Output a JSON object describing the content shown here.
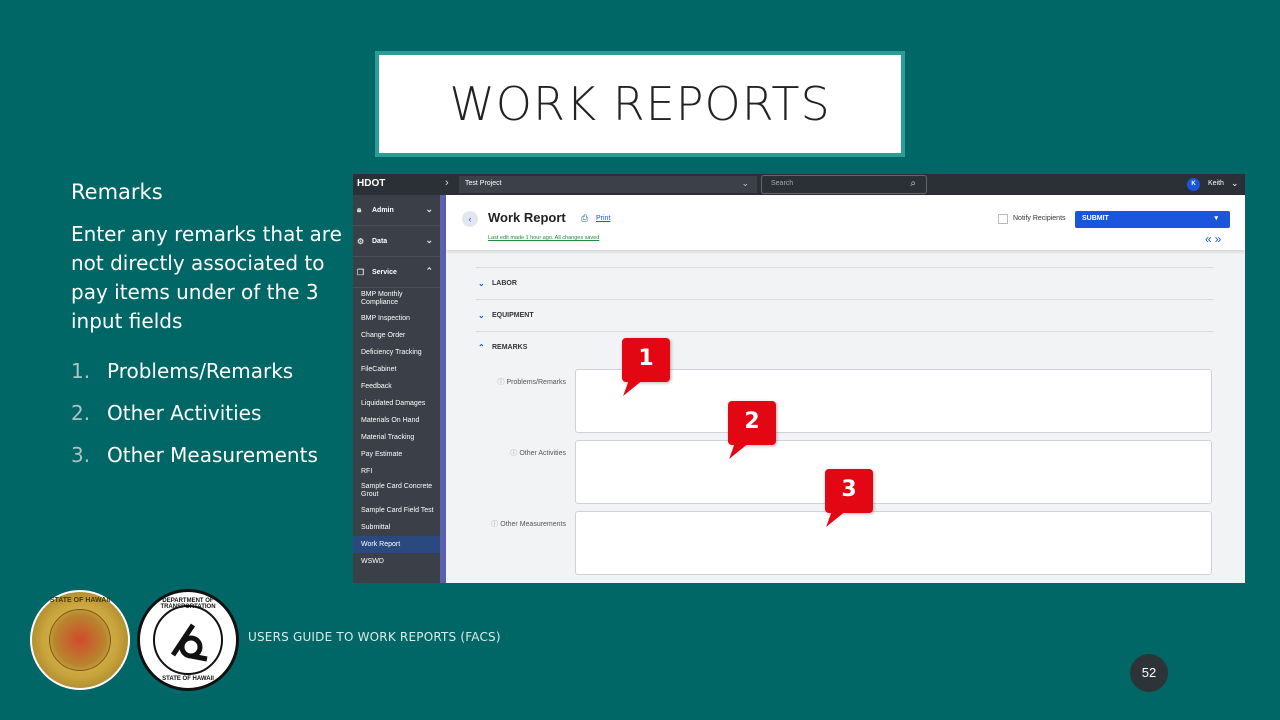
{
  "slide": {
    "title": "WORK REPORTS",
    "heading": "Remarks",
    "body": "Enter any remarks that are not directly associated to pay items under of the 3 input fields",
    "list": [
      {
        "num": "1.",
        "text": "Problems/Remarks"
      },
      {
        "num": "2.",
        "text": "Other Activities"
      },
      {
        "num": "3.",
        "text": "Other Measurements"
      }
    ],
    "footer": "USERS GUIDE TO WORK REPORTS  (FACS)",
    "page_number": "52",
    "seal_hawaii_text": "STATE OF HAWAII",
    "seal_dot_top": "DEPARTMENT OF TRANSPORTATION",
    "seal_dot_bottom": "STATE OF HAWAII"
  },
  "app": {
    "brand": "HDOT",
    "project": "Test Project",
    "search_placeholder": "Search",
    "user_initial": "K",
    "user_name": "Keith",
    "sidebar": {
      "groups": [
        {
          "label": "Admin",
          "icon": "lock-icon"
        },
        {
          "label": "Data",
          "icon": "gears-icon"
        },
        {
          "label": "Service",
          "icon": "copy-icon"
        }
      ],
      "items": [
        "BMP Monthly\nCompliance",
        "BMP Inspection",
        "Change Order",
        "Deficiency Tracking",
        "FileCabinet",
        "Feedback",
        "Liquidated Damages",
        "Materials On Hand",
        "Material Tracking",
        "Pay Estimate",
        "RFI",
        "Sample Card Concrete\nGrout",
        "Sample Card Field Test",
        "Submittal",
        "Work Report",
        "WSWD"
      ],
      "active_item": "Work Report"
    },
    "header": {
      "title": "Work Report",
      "print": "Print",
      "saved": "Last edit made 1 hour ago. All changes saved",
      "notify": "Notify Recipients",
      "submit": "SUBMIT"
    },
    "sections": [
      "LABOR",
      "EQUIPMENT",
      "REMARKS"
    ],
    "fields": [
      {
        "label": "Problems/Remarks",
        "value": ""
      },
      {
        "label": "Other Activities",
        "value": ""
      },
      {
        "label": "Other Measurements",
        "value": ""
      }
    ],
    "callouts": [
      "1",
      "2",
      "3"
    ],
    "colors": {
      "accent": "#1a56db",
      "callout": "#e30613",
      "slide_bg": "#006766"
    }
  }
}
